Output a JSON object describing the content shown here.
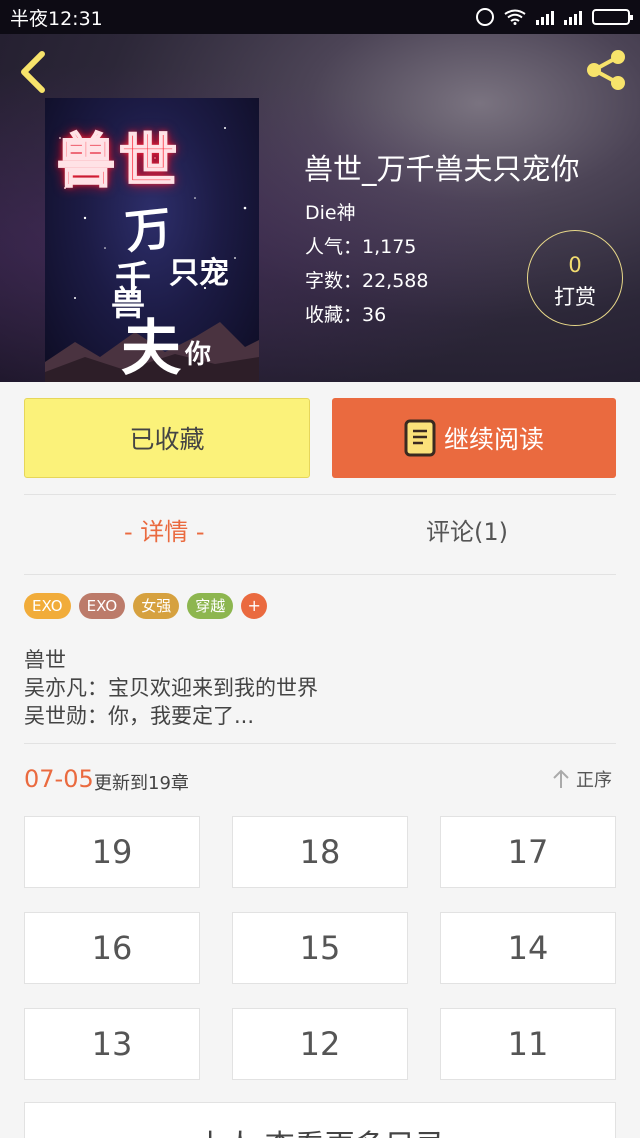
{
  "status_bar": {
    "time": "半夜12:31"
  },
  "book": {
    "title": "兽世_万千兽夫只宠你",
    "author": "Die神",
    "popularity": "人气：1,175",
    "word_count": "字数：22,588",
    "favorites": "收藏：36",
    "cover_text": {
      "neon": "兽世",
      "l1": "万",
      "l2": "千",
      "l3": "只宠",
      "l4": "兽",
      "l5": "夫",
      "l6": "你"
    }
  },
  "tip": {
    "count": "0",
    "label": "打赏"
  },
  "actions": {
    "collected": "已收藏",
    "continue_reading": "继续阅读"
  },
  "tabs": {
    "detail": "- 详情 -",
    "comments": "评论(1)"
  },
  "tags": [
    {
      "label": "EXO",
      "color": "#f1ac3a"
    },
    {
      "label": "EXO",
      "color": "#bc7b6a"
    },
    {
      "label": "女强",
      "color": "#d6a13f"
    },
    {
      "label": "穿越",
      "color": "#8db64f"
    }
  ],
  "tag_more": "+",
  "description": [
    "兽世",
    "吴亦凡：宝贝欢迎来到我的世界",
    "吴世勋：你，我要定了..."
  ],
  "update": {
    "date": "07-05",
    "text": "更新到19章",
    "order": "正序"
  },
  "chapters": [
    "19",
    "18",
    "17",
    "16",
    "15",
    "14",
    "13",
    "12",
    "11"
  ],
  "more_catalog": "土人  查看更多目录",
  "colors": {
    "accent": "#ea6a3f",
    "collected_bg": "#fbf27a",
    "tip_ring": "#e8d889"
  }
}
